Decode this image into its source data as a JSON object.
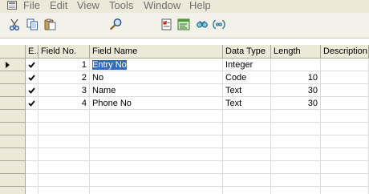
{
  "menu": {
    "items": [
      "File",
      "Edit",
      "View",
      "Tools",
      "Window",
      "Help"
    ]
  },
  "toolbar": {
    "buttons": [
      {
        "name": "cut-button",
        "icon": "scissors-icon"
      },
      {
        "name": "copy-button",
        "icon": "copy-icon"
      },
      {
        "name": "paste-button",
        "icon": "paste-icon"
      },
      {
        "name": "find-button",
        "icon": "magnifier-icon"
      },
      {
        "name": "properties-button",
        "icon": "properties-icon"
      },
      {
        "name": "c-al-button",
        "icon": "code-editor-icon"
      },
      {
        "name": "keys-button",
        "icon": "keys-icon"
      },
      {
        "name": "flowfields-button",
        "icon": "field-link-icon"
      }
    ]
  },
  "grid": {
    "headers": {
      "enabled": "E...",
      "field_no": "Field No.",
      "field_name": "Field Name",
      "data_type": "Data Type",
      "length": "Length",
      "description": "Description"
    },
    "rows": [
      {
        "enabled": true,
        "field_no": "1",
        "field_name": "Entry No",
        "data_type": "Integer",
        "length": "",
        "description": "",
        "current": true
      },
      {
        "enabled": true,
        "field_no": "2",
        "field_name": "No",
        "data_type": "Code",
        "length": "10",
        "description": ""
      },
      {
        "enabled": true,
        "field_no": "3",
        "field_name": "Name",
        "data_type": "Text",
        "length": "30",
        "description": ""
      },
      {
        "enabled": true,
        "field_no": "4",
        "field_name": "Phone No",
        "data_type": "Text",
        "length": "30",
        "description": ""
      }
    ],
    "empty_rows": 7
  },
  "colors": {
    "selection": "#316ac5",
    "chrome": "#ece9d8",
    "menu_text": "#6f6f6f"
  }
}
